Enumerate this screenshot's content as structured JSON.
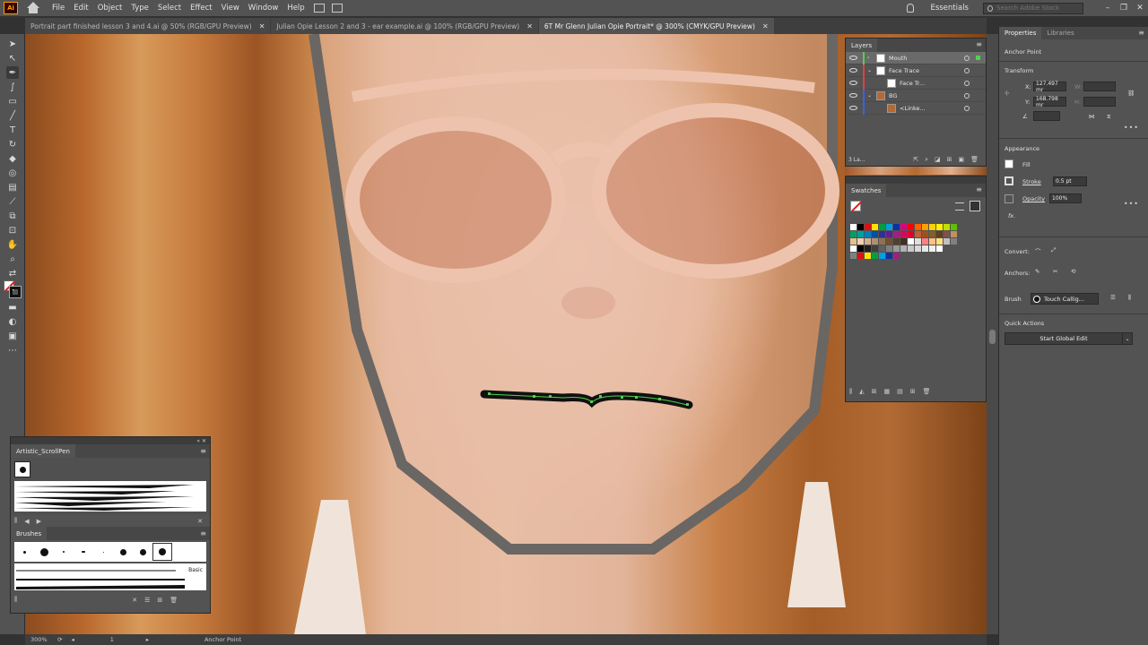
{
  "menu": {
    "logo": "Ai",
    "items": [
      "File",
      "Edit",
      "Object",
      "Type",
      "Select",
      "Effect",
      "View",
      "Window",
      "Help"
    ],
    "workspace": "Essentials",
    "search_placeholder": "Search Adobe Stock"
  },
  "tabs": [
    {
      "label": "Portrait part finished lesson 3 and 4.ai @ 50% (RGB/GPU Preview)",
      "active": false
    },
    {
      "label": "Julian Opie Lesson 2 and 3 - ear example.ai @ 100% (RGB/GPU Preview)",
      "active": false
    },
    {
      "label": "6T Mr Glenn Julian Opie Portrait* @ 300% (CMYK/GPU Preview)",
      "active": true
    }
  ],
  "brush_panel": {
    "library_tab": "Artistic_ScrollPen",
    "brushes_tab": "Brushes",
    "basic_label": "Basic"
  },
  "layers": {
    "tab": "Layers",
    "rows": [
      {
        "name": "Mouth",
        "color": "#4fd24f",
        "active": true,
        "expand": "›"
      },
      {
        "name": "Face Trace",
        "color": "#e04040",
        "active": false,
        "expand": "⌄"
      },
      {
        "name": "Face Tr...",
        "color": "#e04040",
        "active": false,
        "expand": ""
      },
      {
        "name": "BG",
        "color": "#4060e0",
        "active": false,
        "expand": "⌄"
      },
      {
        "name": "<Linke...",
        "color": "#4060e0",
        "active": false,
        "expand": ""
      }
    ],
    "count": "3 La..."
  },
  "swatches": {
    "tab": "Swatches",
    "colors": [
      "#ffffff",
      "#000000",
      "#e01010",
      "#ffe400",
      "#00a040",
      "#00a0e0",
      "#1030a0",
      "#e00080",
      "#ff0000",
      "#ff6000",
      "#ffa000",
      "#ffd000",
      "#fff000",
      "#c0e000",
      "#60c000",
      "#00a060",
      "#00a0a0",
      "#0080c0",
      "#0050a0",
      "#303090",
      "#602090",
      "#a02080",
      "#e00060",
      "#e00030",
      "#c06030",
      "#a05020",
      "#806030",
      "#604020",
      "#805050",
      "#c09060",
      "#e0c090",
      "#f0d0b0",
      "#d0b090",
      "#b09070",
      "#907050",
      "#705030",
      "#504030",
      "#403020",
      "#ffffff",
      "#e0e0e0",
      "#ff8080",
      "#ffc080",
      "#ffe080",
      "#c0c0c0",
      "#808080",
      "#ffffff",
      "#000000",
      "#202020",
      "#404040",
      "#606060",
      "#808080",
      "#999999",
      "#b0b0b0",
      "#c8c8c8",
      "#d8d8d8",
      "#e8e8e8",
      "#f0f0f0",
      "#ffffff",
      "#535353",
      "#535353",
      "#808080",
      "#e01010",
      "#ffe400",
      "#00a040",
      "#00a0e0",
      "#1030a0",
      "#a02080",
      "#535353",
      "#535353",
      "#535353",
      "#535353",
      "#535353",
      "#535353",
      "#535353",
      "#535353"
    ]
  },
  "properties": {
    "tab": "Properties",
    "libraries_tab": "Libraries",
    "selection": "Anchor Point",
    "transform": "Transform",
    "x_label": "X:",
    "x_value": "127.497 mr",
    "y_label": "Y:",
    "y_value": "168.798 mr",
    "w_label": "W:",
    "h_label": "H:",
    "appearance": "Appearance",
    "fill_label": "Fill",
    "stroke_label": "Stroke",
    "stroke_value": "0.5 pt",
    "opacity_label": "Opacity",
    "opacity_value": "100%",
    "fx": "fx.",
    "convert_label": "Convert:",
    "anchors_label": "Anchors:",
    "brush_label": "Brush",
    "brush_value": "Touch Callig...",
    "quick_actions": "Quick Actions",
    "global_edit": "Start Global Edit"
  },
  "status": {
    "zoom": "300%",
    "page": "1",
    "tool": "Anchor Point"
  }
}
